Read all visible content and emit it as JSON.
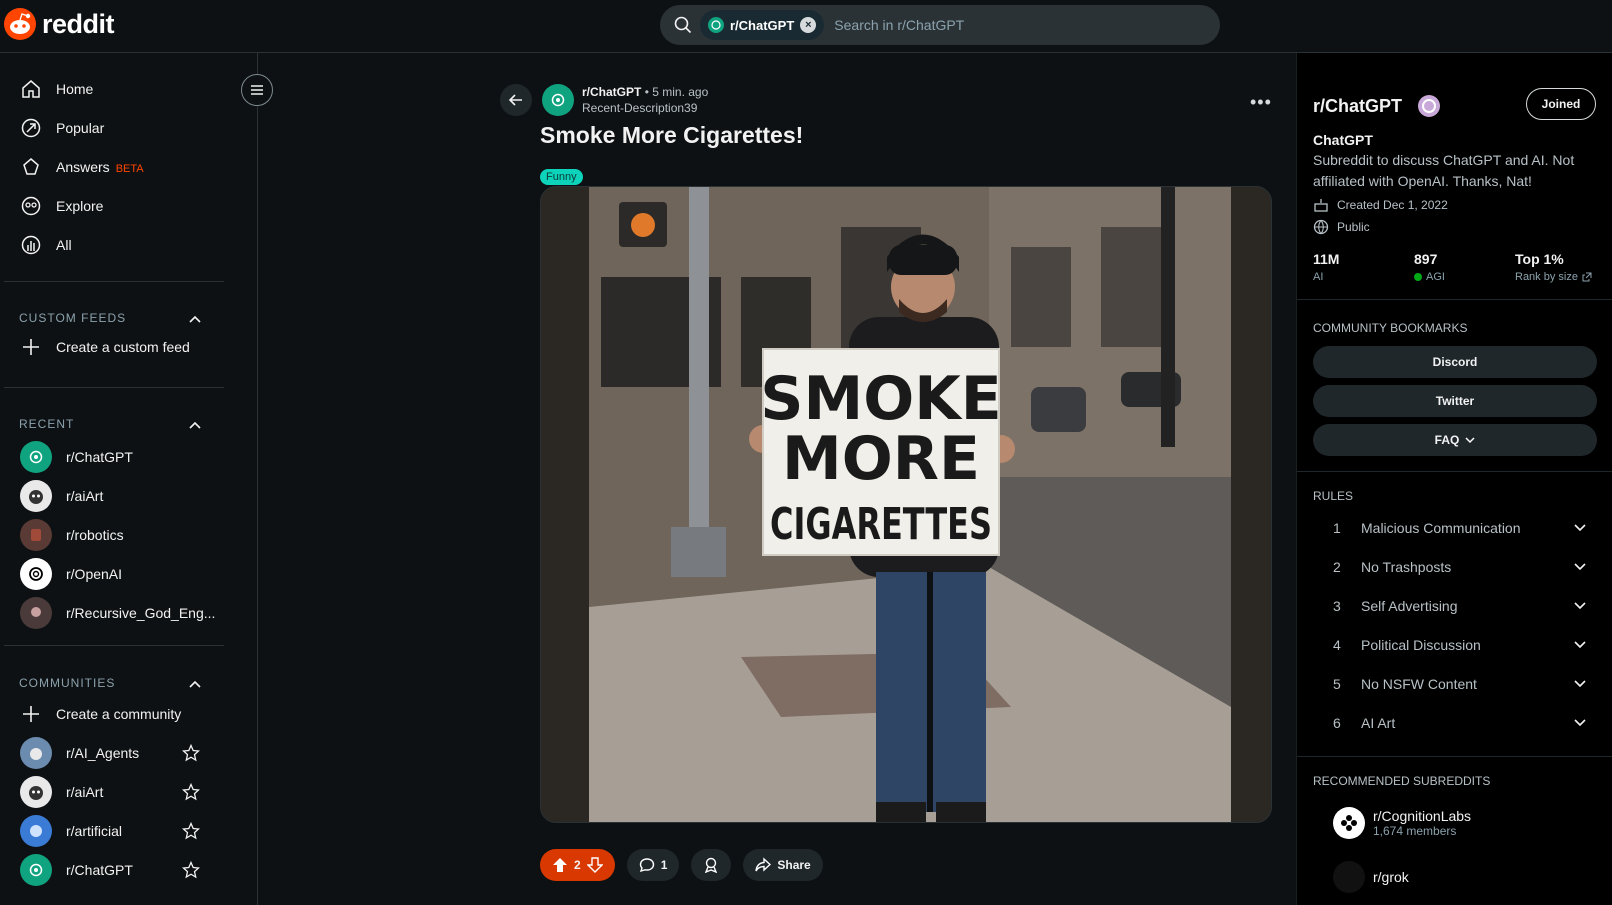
{
  "header": {
    "logo_text": "reddit",
    "search_chip": "r/ChatGPT",
    "search_placeholder": "Search in r/ChatGPT"
  },
  "sidebar": {
    "nav": [
      {
        "label": "Home",
        "icon": "home-icon"
      },
      {
        "label": "Popular",
        "icon": "popular-icon"
      },
      {
        "label": "Answers",
        "icon": "answers-icon",
        "badge": "BETA"
      },
      {
        "label": "Explore",
        "icon": "explore-icon"
      },
      {
        "label": "All",
        "icon": "all-icon"
      }
    ],
    "custom_feeds_title": "CUSTOM FEEDS",
    "create_feed": "Create a custom feed",
    "recent_title": "RECENT",
    "recent": [
      "r/ChatGPT",
      "r/aiArt",
      "r/robotics",
      "r/OpenAI",
      "r/Recursive_God_Eng..."
    ],
    "communities_title": "COMMUNITIES",
    "create_community": "Create a community",
    "communities": [
      "r/AI_Agents",
      "r/aiArt",
      "r/artificial",
      "r/ChatGPT"
    ]
  },
  "post": {
    "subreddit": "r/ChatGPT",
    "time": "• 5 min. ago",
    "author": "Recent-Description39",
    "title": "Smoke More Cigarettes!",
    "flair": "Funny",
    "image_sign_line1": "SMOKE",
    "image_sign_line2": "MORE",
    "image_sign_line3": "CIGARETTES",
    "votes": "2",
    "comments": "1",
    "share_label": "Share"
  },
  "community": {
    "title": "r/ChatGPT",
    "joined_label": "Joined",
    "name": "ChatGPT",
    "description": "Subreddit to discuss ChatGPT and AI. Not affiliated with OpenAI. Thanks, Nat!",
    "created": "Created Dec 1, 2022",
    "visibility": "Public",
    "stats": [
      {
        "value": "11M",
        "label": "AI"
      },
      {
        "value": "897",
        "label": "AGI"
      },
      {
        "value": "Top 1%",
        "label": "Rank by size"
      }
    ],
    "bookmarks_title": "COMMUNITY BOOKMARKS",
    "bookmarks": [
      "Discord",
      "Twitter",
      "FAQ"
    ],
    "rules_title": "RULES",
    "rules": [
      {
        "num": "1",
        "text": "Malicious Communication"
      },
      {
        "num": "2",
        "text": "No Trashposts"
      },
      {
        "num": "3",
        "text": "Self Advertising"
      },
      {
        "num": "4",
        "text": "Political Discussion"
      },
      {
        "num": "5",
        "text": "No NSFW Content"
      },
      {
        "num": "6",
        "text": "AI Art"
      }
    ],
    "recommended_title": "RECOMMENDED SUBREDDITS",
    "recommended": [
      {
        "name": "r/CognitionLabs",
        "members": "1,674 members"
      },
      {
        "name": "r/grok"
      }
    ]
  },
  "colors": {
    "brand": "#ff4500",
    "flair": "#0dd3bb",
    "vote": "#d93900",
    "online": "#01a816"
  }
}
